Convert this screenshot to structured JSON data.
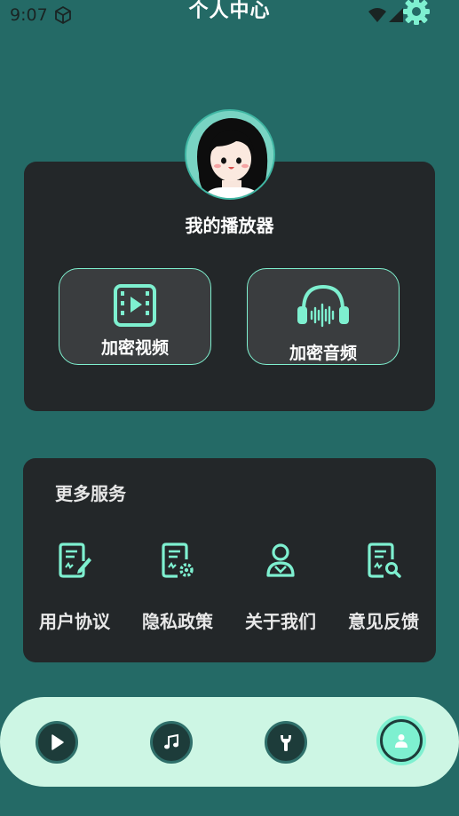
{
  "status_bar": {
    "time": "9:07"
  },
  "header": {
    "title": "个人中心"
  },
  "player": {
    "title": "我的播放器",
    "buttons": [
      {
        "label": "加密视频",
        "icon": "video-icon"
      },
      {
        "label": "加密音频",
        "icon": "headphones-icon"
      }
    ]
  },
  "services": {
    "title": "更多服务",
    "items": [
      {
        "label": "用户协议",
        "icon": "document-edit-icon"
      },
      {
        "label": "隐私政策",
        "icon": "document-settings-icon"
      },
      {
        "label": "关于我们",
        "icon": "user-icon"
      },
      {
        "label": "意见反馈",
        "icon": "document-search-icon"
      }
    ]
  },
  "bottom_nav": {
    "items": [
      {
        "icon": "play-icon",
        "active": false
      },
      {
        "icon": "music-note-icon",
        "active": false
      },
      {
        "icon": "tools-icon",
        "active": false
      },
      {
        "icon": "profile-icon",
        "active": true
      }
    ]
  },
  "colors": {
    "background": "#246a66",
    "card": "#232729",
    "accent": "#7ff0cf",
    "nav_background": "#cdf6e4"
  }
}
